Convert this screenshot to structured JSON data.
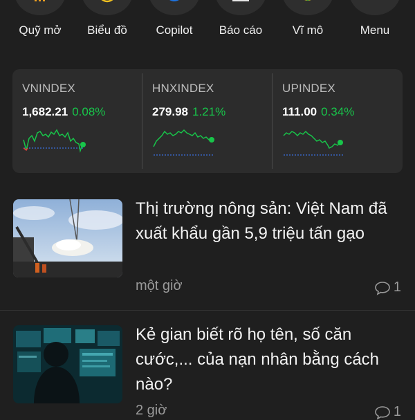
{
  "shortcuts": [
    {
      "label": "Quỹ mở",
      "icon": "fund-icon"
    },
    {
      "label": "Biểu đồ",
      "icon": "chart-icon"
    },
    {
      "label": "Copilot",
      "icon": "copilot-icon"
    },
    {
      "label": "Báo cáo",
      "icon": "report-icon"
    },
    {
      "label": "Vĩ mô",
      "icon": "macro-icon"
    },
    {
      "label": "Menu",
      "icon": "menu-icon"
    }
  ],
  "indices": [
    {
      "name": "VNINDEX",
      "value": "1,682.21",
      "change": "0.08%"
    },
    {
      "name": "HNXINDEX",
      "value": "279.98",
      "change": "1.21%"
    },
    {
      "name": "UPINDEX",
      "value": "111.00",
      "change": "0.34%"
    }
  ],
  "colors": {
    "up": "#18c54a",
    "down": "#e03b3b",
    "reference": "#3a6fe0"
  },
  "news": [
    {
      "title": "Thị trường nông sản: Việt Nam đã xuất khẩu gần 5,9 triệu tấn gạo",
      "time": "một giờ",
      "comments": "1",
      "thumb": "rice-export-image"
    },
    {
      "title": "Kẻ gian biết rõ họ tên, số căn cước,... của nạn nhân bằng cách nào?",
      "time": "2 giờ",
      "comments": "1",
      "thumb": "hacker-image"
    }
  ]
}
